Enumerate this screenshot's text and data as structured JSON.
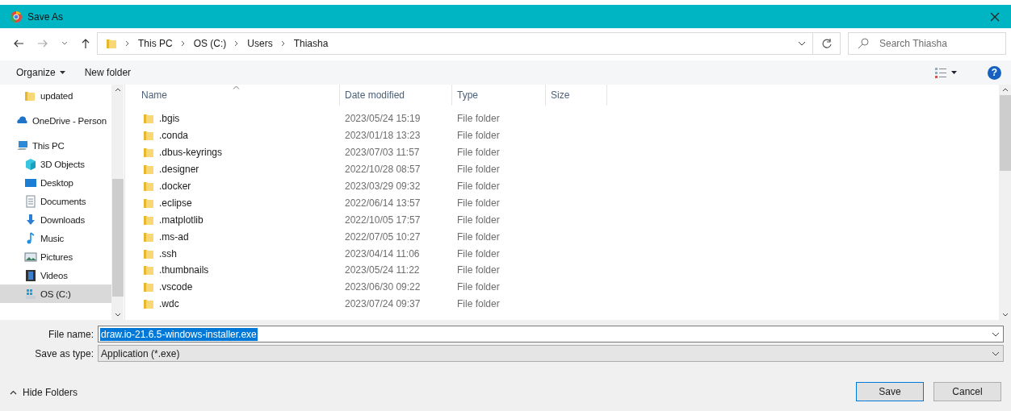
{
  "window": {
    "title": "Save As"
  },
  "address_bar": {
    "path": [
      "This PC",
      "OS (C:)",
      "Users",
      "Thiasha"
    ]
  },
  "search": {
    "placeholder": "Search Thiasha"
  },
  "toolbar": {
    "organize": "Organize",
    "new_folder": "New folder",
    "help": "?"
  },
  "sidebar": {
    "items": [
      {
        "label": "updated",
        "kind": "folder",
        "selected": false
      },
      {
        "label": "OneDrive - Person",
        "kind": "cloud",
        "selected": false
      },
      {
        "label": "This PC",
        "kind": "pc",
        "selected": false,
        "children": [
          {
            "label": "3D Objects",
            "kind": "cube",
            "selected": false
          },
          {
            "label": "Desktop",
            "kind": "desktop",
            "selected": false
          },
          {
            "label": "Documents",
            "kind": "documents",
            "selected": false
          },
          {
            "label": "Downloads",
            "kind": "downloads",
            "selected": false
          },
          {
            "label": "Music",
            "kind": "music",
            "selected": false
          },
          {
            "label": "Pictures",
            "kind": "pictures",
            "selected": false
          },
          {
            "label": "Videos",
            "kind": "videos",
            "selected": false
          },
          {
            "label": "OS (C:)",
            "kind": "drive",
            "selected": true
          }
        ]
      }
    ]
  },
  "table": {
    "columns": [
      {
        "label": "Name",
        "sorted": true
      },
      {
        "label": "Date modified",
        "sorted": false
      },
      {
        "label": "Type",
        "sorted": false
      },
      {
        "label": "Size",
        "sorted": false
      }
    ],
    "rows": [
      {
        "name": ".bgis",
        "date": "2023/05/24 15:19",
        "type": "File folder"
      },
      {
        "name": ".conda",
        "date": "2023/01/18 13:23",
        "type": "File folder"
      },
      {
        "name": ".dbus-keyrings",
        "date": "2023/07/03 11:57",
        "type": "File folder"
      },
      {
        "name": ".designer",
        "date": "2022/10/28 08:57",
        "type": "File folder"
      },
      {
        "name": ".docker",
        "date": "2023/03/29 09:32",
        "type": "File folder"
      },
      {
        "name": ".eclipse",
        "date": "2022/06/14 13:57",
        "type": "File folder"
      },
      {
        "name": ".matplotlib",
        "date": "2022/10/05 17:57",
        "type": "File folder"
      },
      {
        "name": ".ms-ad",
        "date": "2022/07/05 10:27",
        "type": "File folder"
      },
      {
        "name": ".ssh",
        "date": "2023/04/14 11:06",
        "type": "File folder"
      },
      {
        "name": ".thumbnails",
        "date": "2023/05/24 11:22",
        "type": "File folder"
      },
      {
        "name": ".vscode",
        "date": "2023/06/30 09:22",
        "type": "File folder"
      },
      {
        "name": ".wdc",
        "date": "2023/07/24 09:37",
        "type": "File folder"
      }
    ]
  },
  "form": {
    "file_name_label": "File name:",
    "file_name": "draw.io-21.6.5-windows-installer.exe",
    "file_name_selected": true,
    "type_label": "Save as type:",
    "type_value": "Application (*.exe)"
  },
  "footer": {
    "hide_folders": "Hide Folders",
    "save": "Save",
    "cancel": "Cancel"
  }
}
